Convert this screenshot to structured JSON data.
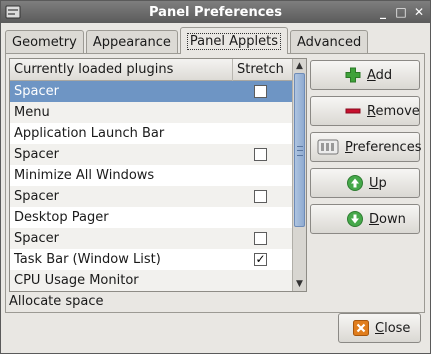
{
  "window": {
    "title": "Panel Preferences",
    "controls": {
      "minimize": "_",
      "maximize": "□",
      "close": "✕"
    }
  },
  "tabs": [
    {
      "label": "Geometry",
      "active": false
    },
    {
      "label": "Appearance",
      "active": false
    },
    {
      "label": "Panel Applets",
      "active": true
    },
    {
      "label": "Advanced",
      "active": false
    }
  ],
  "plugins_list": {
    "headers": {
      "plugins": "Currently loaded plugins",
      "stretch": "Stretch"
    },
    "rows": [
      {
        "name": "Spacer",
        "has_stretch": true,
        "stretch_checked": false,
        "selected": true
      },
      {
        "name": "Menu",
        "has_stretch": false,
        "stretch_checked": false,
        "selected": false
      },
      {
        "name": "Application Launch Bar",
        "has_stretch": false,
        "stretch_checked": false,
        "selected": false
      },
      {
        "name": "Spacer",
        "has_stretch": true,
        "stretch_checked": false,
        "selected": false
      },
      {
        "name": "Minimize All Windows",
        "has_stretch": false,
        "stretch_checked": false,
        "selected": false
      },
      {
        "name": "Spacer",
        "has_stretch": true,
        "stretch_checked": false,
        "selected": false
      },
      {
        "name": "Desktop Pager",
        "has_stretch": false,
        "stretch_checked": false,
        "selected": false
      },
      {
        "name": "Spacer",
        "has_stretch": true,
        "stretch_checked": false,
        "selected": false
      },
      {
        "name": "Task Bar (Window List)",
        "has_stretch": true,
        "stretch_checked": true,
        "selected": false
      },
      {
        "name": "CPU Usage Monitor",
        "has_stretch": false,
        "stretch_checked": false,
        "selected": false
      }
    ],
    "check_mark": "✓",
    "scroll_arrows": {
      "up": "▲",
      "down": "▼"
    }
  },
  "status_text": "Allocate space",
  "buttons": {
    "add": {
      "mnemonic": "A",
      "rest": "dd",
      "icon": "plus-icon"
    },
    "remove": {
      "mnemonic": "R",
      "rest": "emove",
      "icon": "minus-icon"
    },
    "preferences": {
      "mnemonic": "P",
      "rest": "references",
      "icon": "preferences-icon"
    },
    "up": {
      "mnemonic": "U",
      "rest": "p",
      "icon": "arrow-up-icon"
    },
    "down": {
      "mnemonic": "D",
      "rest": "own",
      "icon": "arrow-down-icon"
    },
    "close": {
      "mnemonic": "C",
      "rest": "lose",
      "icon": "close-icon"
    }
  },
  "colors": {
    "titlebar": "#5b5b5b",
    "selection": "#6e95c4",
    "add_green": "#3fa23a",
    "remove_red": "#c8102e",
    "arrow_green": "#46a84a",
    "close_orange": "#e07d1c"
  }
}
